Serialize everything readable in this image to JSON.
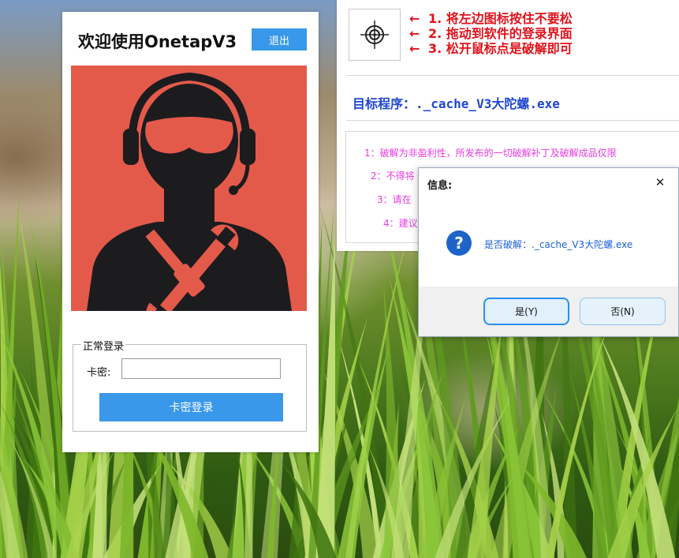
{
  "login_window": {
    "title": "欢迎使用OnetapV3",
    "exit_label": "退出",
    "avatar_icon": "support-agent-with-tools-icon",
    "avatar_bg_color": "#e45a4a",
    "group_title": "正常登录",
    "key_label": "卡密:",
    "key_value": "",
    "key_login_label": "卡密登录"
  },
  "tool_window": {
    "target_icon": "crosshair-target-icon",
    "steps": [
      "1. 将左边图标按住不要松",
      "2. 拖动到软件的登录界面",
      "3. 松开鼠标点是破解即可"
    ],
    "step_arrow": "←",
    "target_program_label": "目标程序：._cache_V3大陀螺.exe",
    "notes": [
      "1：破解为非盈利性，所发布的一切破解补丁及破解成品仅限",
      "2：不得将",
      "3：请在",
      "4：建议"
    ]
  },
  "dialog": {
    "title": "信息:",
    "close_label": "✕",
    "icon": "question-icon",
    "message": "是否破解：._cache_V3大陀螺.exe",
    "yes_label": "是(Y)",
    "no_label": "否(N)"
  },
  "colors": {
    "accent": "#3a98ea",
    "steps_red": "#e0121b",
    "target_blue": "#1f46d0",
    "notes_magenta": "#e83be0"
  }
}
